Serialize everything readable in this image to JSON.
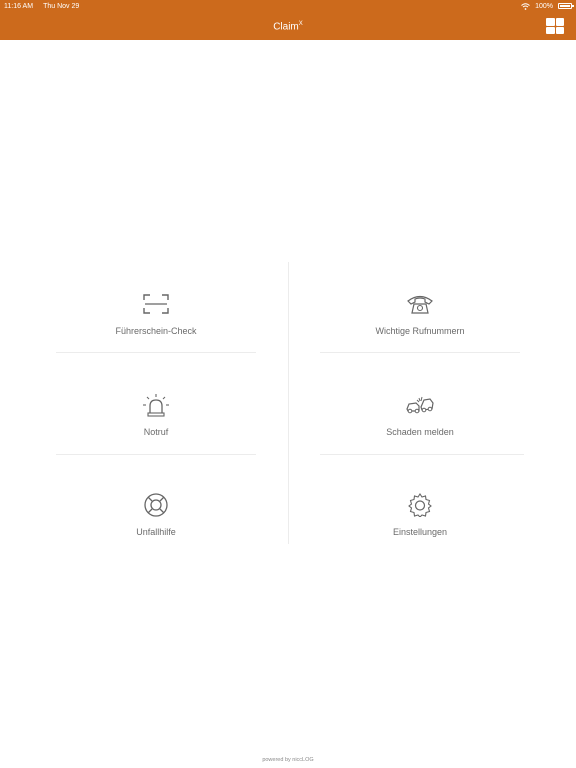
{
  "status": {
    "time": "11:16 AM",
    "date": "Thu Nov 29",
    "battery": "100%"
  },
  "nav": {
    "title": "Claim",
    "title_sup": "X"
  },
  "tiles": [
    {
      "label": "Führerschein-Check",
      "icon": "scan-frame-icon"
    },
    {
      "label": "Wichtige Rufnummern",
      "icon": "telephone-icon"
    },
    {
      "label": "Notruf",
      "icon": "siren-icon"
    },
    {
      "label": "Schaden melden",
      "icon": "car-crash-icon"
    },
    {
      "label": "Unfallhilfe",
      "icon": "lifebuoy-icon"
    },
    {
      "label": "Einstellungen",
      "icon": "gear-icon"
    }
  ],
  "footer": {
    "text": "powered by niccLOG"
  },
  "colors": {
    "brand": "#cc6a1c"
  }
}
